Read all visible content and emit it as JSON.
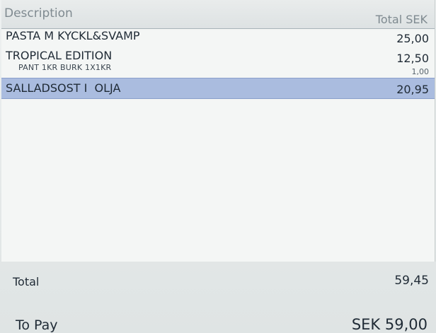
{
  "header": {
    "description_label": "Description",
    "total_label": "Total SEK"
  },
  "items": [
    {
      "name": "PASTA M KYCKL&SVAMP",
      "amount": "25,00"
    },
    {
      "name": "TROPICAL EDITION",
      "amount": "12,50",
      "sub_name": "PANT 1KR BURK 1X1KR",
      "sub_amount": "1,00"
    },
    {
      "name": "SALLADSOST I  OLJA",
      "amount": "20,95",
      "selected": true
    }
  ],
  "summary": {
    "total_label": "Total",
    "total_value": "59,45",
    "topay_label": "To Pay",
    "topay_value": "SEK 59,00"
  },
  "colors": {
    "selected_row": "#aabcdf",
    "background": "#e2e6e6"
  }
}
